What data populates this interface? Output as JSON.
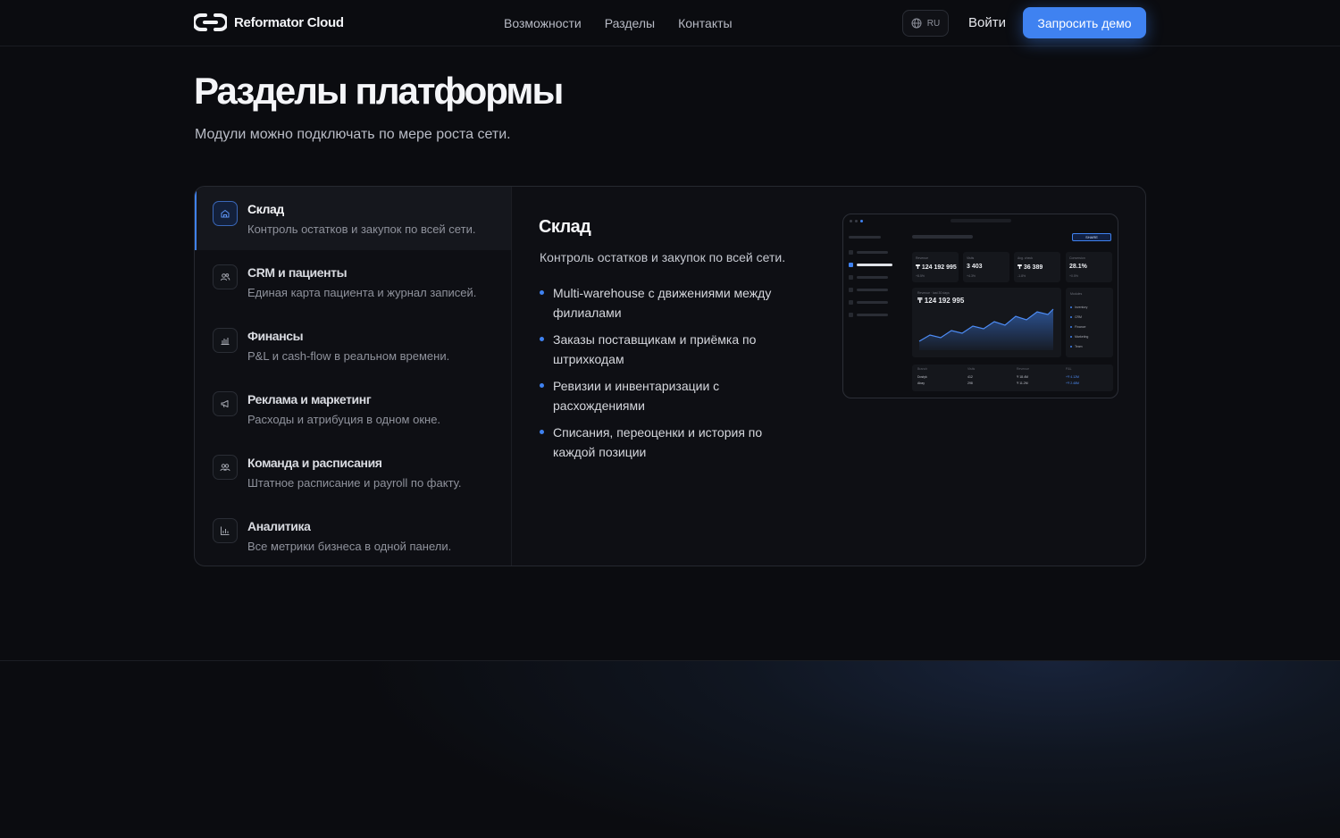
{
  "header": {
    "brand": "Reformator Cloud",
    "nav": [
      "Возможности",
      "Разделы",
      "Контакты"
    ],
    "lang": "RU",
    "login": "Войти",
    "cta": "Запросить демо"
  },
  "hero": {
    "title": "Разделы платформы",
    "subtitle": "Модули можно подключать по мере роста сети."
  },
  "sections": {
    "tabs": [
      {
        "title": "Склад",
        "desc": "Контроль остатков и закупок по всей сети.",
        "icon": "warehouse-icon",
        "active": true
      },
      {
        "title": "CRM и пациенты",
        "desc": "Единая карта пациента и журнал записей.",
        "icon": "users-icon",
        "active": false
      },
      {
        "title": "Финансы",
        "desc": "P&L и cash-flow в реальном времени.",
        "icon": "finance-chart-icon",
        "active": false
      },
      {
        "title": "Реклама и маркетинг",
        "desc": "Расходы и атрибуция в одном окне.",
        "icon": "megaphone-icon",
        "active": false
      },
      {
        "title": "Команда и расписания",
        "desc": "Штатное расписание и payroll по факту.",
        "icon": "team-icon",
        "active": false
      },
      {
        "title": "Аналитика",
        "desc": "Все метрики бизнеса в одной панели.",
        "icon": "analytics-icon",
        "active": false
      }
    ],
    "detail": {
      "title": "Склад",
      "desc": "Контроль остатков и закупок по всей сети.",
      "bullets": [
        "Multi-warehouse с движениями между филиалами",
        "Заказы поставщикам и приёмка по штрихкодам",
        "Ревизии и инвентаризации с расхождениями",
        "Списания, переоценки и история по каждой позиции"
      ]
    },
    "mock": {
      "share": "SHARE",
      "kpis": [
        {
          "label": "Revenue",
          "value": "₸ 124 192 995",
          "delta": "+8.5%"
        },
        {
          "label": "Visits",
          "value": "3 403",
          "delta": "+4.3%"
        },
        {
          "label": "Avg. check",
          "value": "₸ 36 389",
          "delta": "-1.8%"
        },
        {
          "label": "Conversion",
          "value": "28.1%",
          "delta": "+0.5%"
        }
      ],
      "chart_label": "Revenue · last 30 days",
      "chart_value": "₸ 124 192 995",
      "modules_title": "Modules",
      "modules": [
        "Inventory",
        "CRM",
        "Finance",
        "Marketing",
        "Team"
      ],
      "table_headers": [
        "Branch",
        "Visits",
        "Revenue",
        "P&L"
      ],
      "table_rows": [
        [
          "Dostyk",
          "412",
          "₸ 18.4M",
          "+₸ 4.12M"
        ],
        [
          "Abay",
          "298",
          "₸ 11.2M",
          "+₸ 2.48M"
        ]
      ]
    }
  },
  "colors": {
    "accent": "#3f82f1",
    "background": "#0b0c10",
    "card": "#0e0f14"
  }
}
